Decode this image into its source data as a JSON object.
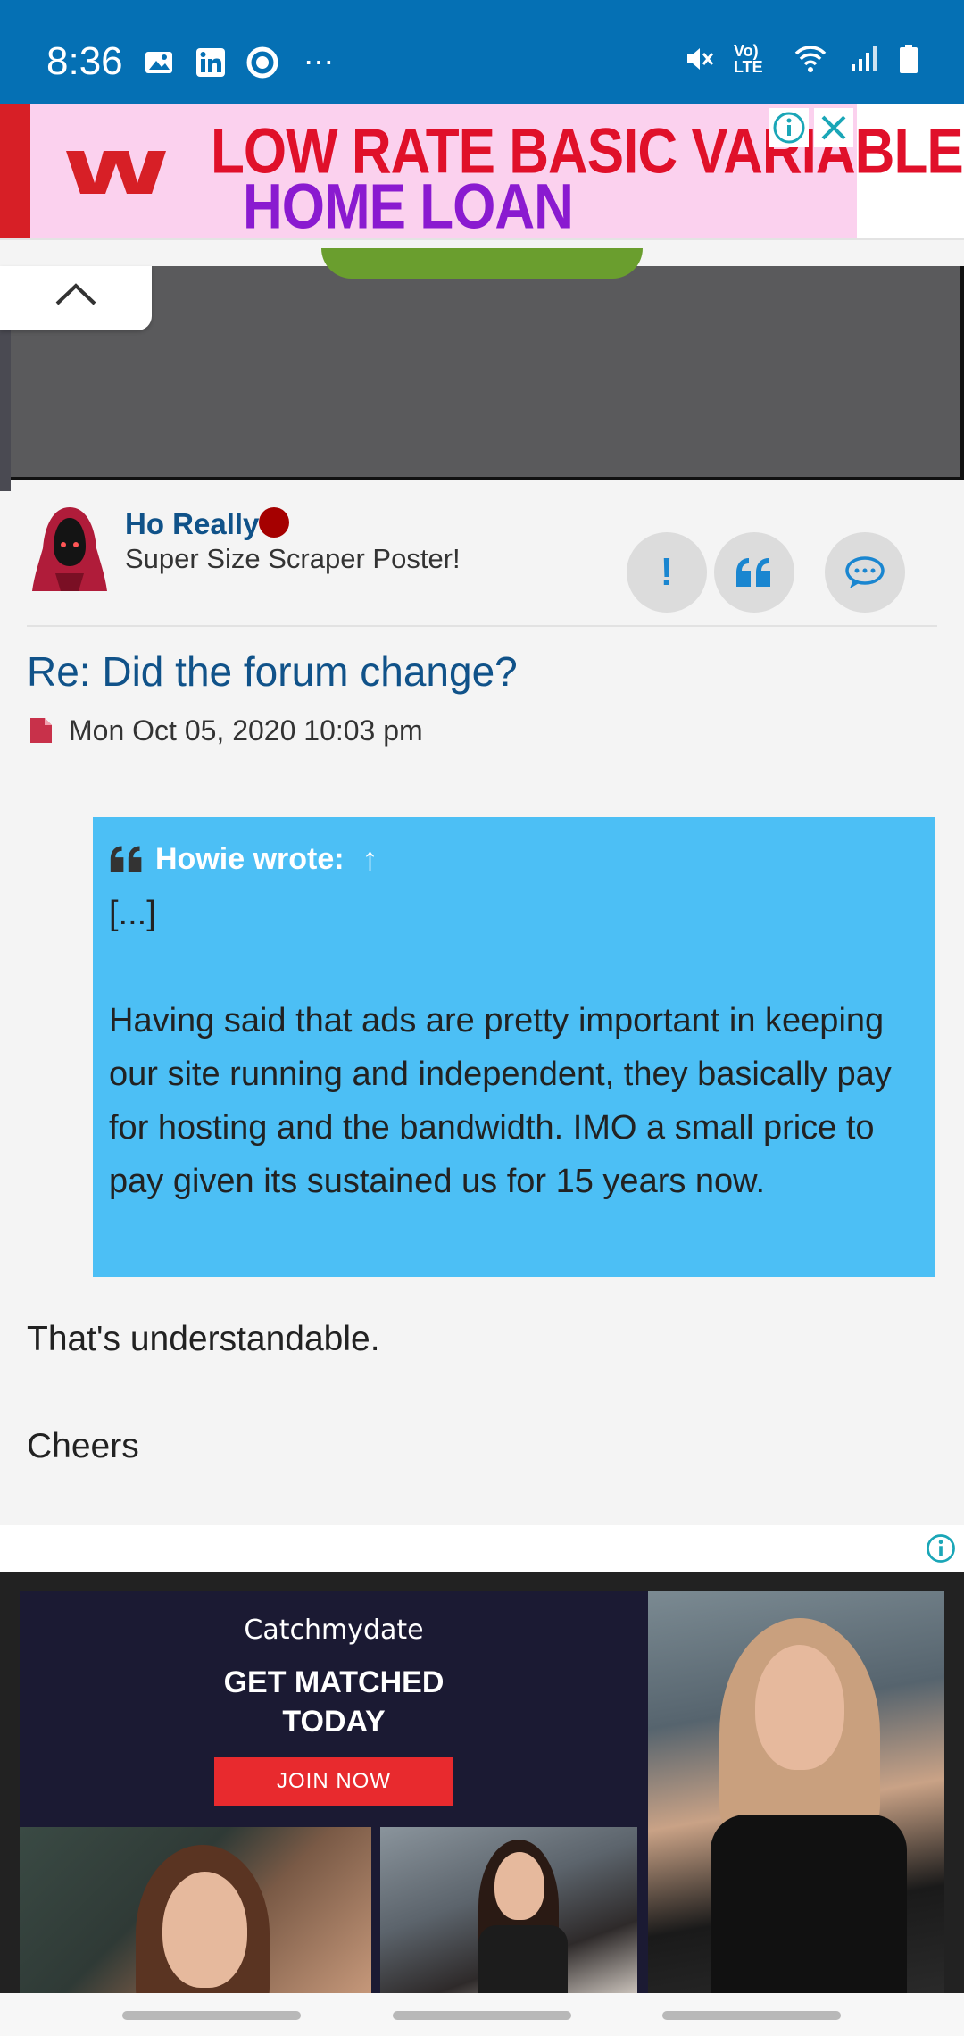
{
  "status_bar": {
    "time": "8:36",
    "left_icons": [
      "image-icon",
      "linkedin-icon",
      "circle-app-icon",
      "more-dots-icon"
    ],
    "right_icons": [
      "muted-icon",
      "volte-icon",
      "wifi-icon",
      "signal-icon",
      "battery-icon"
    ],
    "volte_label": "Vo) LTE",
    "more_label": "⋯"
  },
  "ad_top": {
    "line1": "LOW RATE BASIC VARIABLE",
    "line2": "HOME LOAN",
    "colors": {
      "bar": "#d71f26",
      "background": "#fbd1ee",
      "line1": "#e0102a",
      "line2": "#8a1ad0"
    }
  },
  "post": {
    "username": "Ho Really",
    "rank": "Super Size Scraper Poster!",
    "title": "Re: Did the forum change?",
    "date": "Mon Oct 05, 2020 10:03 pm",
    "actions": [
      "report-icon",
      "quote-icon",
      "pm-icon"
    ],
    "quote": {
      "author": "Howie wrote:",
      "arrow": "↑",
      "lines": [
        "[...]",
        "Having said that ads are pretty important in keeping our site running and independent, they basically pay for hosting and the bandwidth. IMO a small price to pay given its sustained us for 15 years now."
      ]
    },
    "reply_lines": [
      "That's understandable.",
      "Cheers"
    ],
    "colors": {
      "link": "#105289",
      "quote_bg": "#4cbff5",
      "online": "#a50000"
    }
  },
  "ad_bottom": {
    "brand": "Catchmydate",
    "headline_1": "GET MATCHED",
    "headline_2": "TODAY",
    "cta": "JOIN NOW",
    "colors": {
      "panel": "#1b1a33",
      "cta": "#e82a2e"
    }
  }
}
